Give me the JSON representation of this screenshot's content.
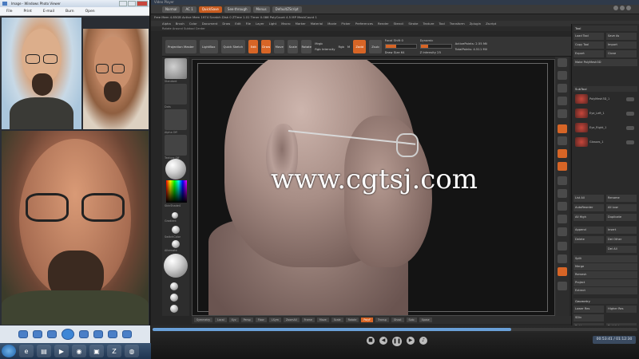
{
  "viewer": {
    "title": "Image - Windows Photo Viewer",
    "menu": [
      "File",
      "Print",
      "E-mail",
      "Burn",
      "Open"
    ]
  },
  "zbrush": {
    "title": "Video Player",
    "top_buttons": [
      {
        "label": "Normal"
      },
      {
        "label": "AC 1"
      },
      {
        "label": "QuickSave",
        "accent": true
      },
      {
        "label": "See-through"
      },
      {
        "label": "Menus"
      },
      {
        "label": "DefaultZScript"
      }
    ],
    "info_line": "Free Mem 4.85GB Active Mem 1974 Scratch Disk 0 ZTime 1.01 Timer 0.086 PolyCount 4.5 MP MeshCount 1",
    "menu": [
      "Alpha",
      "Brush",
      "Color",
      "Document",
      "Draw",
      "Edit",
      "File",
      "Layer",
      "Light",
      "Macro",
      "Marker",
      "Material",
      "Movie",
      "Picker",
      "Preferences",
      "Render",
      "Stencil",
      "Stroke",
      "Texture",
      "Tool",
      "Transform",
      "Zplugin",
      "Zscript"
    ],
    "sub_line": "Rotate Around Subtool Center",
    "toolbar": {
      "projection": "Projection Master",
      "lightbox": "LightBox",
      "quick_sketch": "Quick Sketch",
      "edit": "Edit",
      "draw": "Draw",
      "move": "Move",
      "scale": "Scale",
      "rotate": "Rotate",
      "mrgb": "Mrgb",
      "rgb": "Rgb",
      "m": "M",
      "rgb_intensity": "Rgb Intensity",
      "zadd": "Zadd",
      "zsub": "Zsub",
      "focal_shift_label": "Focal Shift 0",
      "draw_size_label": "Draw Size 64",
      "z_intensity_label": "Z Intensity 25",
      "dynamic": "Dynamic",
      "active_points": "ActivePoints: 2.55 Mil",
      "total_points": "TotalPoints: 4.511 Mil"
    },
    "left_labels": [
      "Standard",
      "Dots",
      "Alpha Off",
      "Texture Off",
      "SkinShade4",
      "Gradient",
      "SwitchColor",
      "Alternate"
    ],
    "watermark": "www.cgtsj.com",
    "tray": {
      "title": "Tool",
      "load": "Load Tool",
      "save": "Save As",
      "copy": "Copy Tool",
      "import": "Import",
      "export": "Export",
      "clone": "Clone",
      "make_polymesh": "Make PolyMesh3D",
      "subtool": "SubTool",
      "subtools": [
        {
          "name": "PolyMesh3D_1"
        },
        {
          "name": "Eye_Left_1"
        },
        {
          "name": "Eye_Right_1"
        },
        {
          "name": "Glasses_1"
        }
      ],
      "list_all": "List All",
      "rename": "Rename",
      "auto_reorder": "AutoReorder",
      "all_low": "All Low",
      "all_high": "All High",
      "duplicate": "Duplicate",
      "append": "Append",
      "insert": "Insert",
      "delete": "Delete",
      "del_other": "Del Other",
      "del_all": "Del All",
      "split": "Split",
      "merge": "Merge",
      "remesh": "Remesh",
      "project": "Project",
      "extract": "Extract",
      "geometry": "Geometry",
      "lower_res": "Lower Res",
      "higher_res": "Higher Res",
      "sdiv": "SDiv",
      "del_lower": "Del Lower",
      "del_higher": "Del Higher",
      "freeze": "Freeze SubDivision Levels"
    },
    "bottom_buttons": [
      "Symmetry",
      "Local",
      "Xyz",
      "Persp",
      "Floor",
      "LSym",
      "ZoomAll",
      "Frame",
      "Move",
      "Scale",
      "Rotate",
      "PolyF",
      "Transp",
      "Ghost",
      "Solo",
      "Xpose"
    ],
    "player_clock": "00:53:41 / 01:12:30"
  },
  "progress": {
    "value": 0.74
  },
  "toolbar_sliders": {
    "draw_size": 0.35,
    "z_intensity": 0.25
  },
  "colors": {
    "accent": "#d76526",
    "bg": "#262626"
  },
  "icons": {
    "viewer_controls": [
      "zoom-icon",
      "fit-icon",
      "prev-icon",
      "slideshow-icon",
      "next-icon",
      "rotate-left-icon",
      "rotate-right-icon",
      "delete-icon"
    ],
    "taskbar": [
      "start-icon",
      "ie-icon",
      "explorer-icon",
      "media-player-icon",
      "chrome-icon",
      "photoshop-icon",
      "zbrush-icon",
      "firefox-icon"
    ]
  }
}
